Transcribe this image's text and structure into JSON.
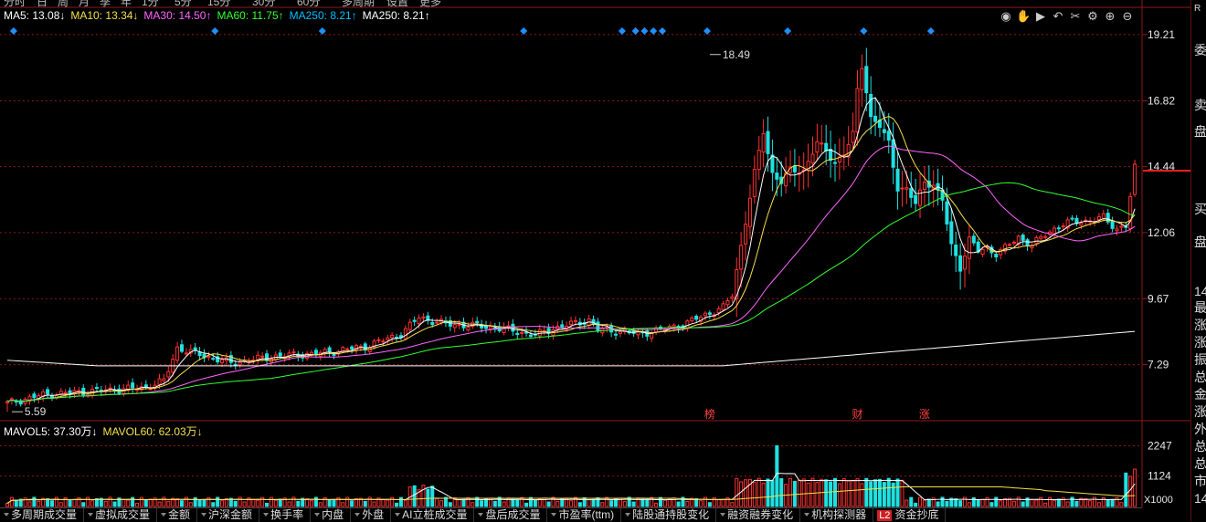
{
  "top_tabs": [
    "分时",
    "日",
    "周",
    "月",
    "季",
    "年",
    "1分",
    "5分",
    "15分",
    "30分",
    "60分",
    "多周期",
    "设置",
    "更多"
  ],
  "ma_legend": [
    {
      "label": "MA5: 13.08↓",
      "color": "#ffffff"
    },
    {
      "label": "MA10: 13.34↓",
      "color": "#f4e04a"
    },
    {
      "label": "MA30: 14.50↑",
      "color": "#ff66ff"
    },
    {
      "label": "MA60: 11.75↑",
      "color": "#33ff33"
    },
    {
      "label": "MA250: 8.21↑",
      "color": "#00bfff"
    },
    {
      "label": "MA250: 8.21↑",
      "color": "#ffffff"
    }
  ],
  "vol_legend": [
    {
      "label": "MAVOL5: 37.30万↓",
      "color": "#ffffff"
    },
    {
      "label": "MAVOL60: 62.03万↓",
      "color": "#f4e04a"
    }
  ],
  "toolbar_icons": [
    "eye-icon",
    "hand-icon",
    "play-icon",
    "undo-icon",
    "cross-icon",
    "gear-icon",
    "zoom-in-icon",
    "zoom-out-icon"
  ],
  "right_panel": {
    "top_icon": "R",
    "chars": [
      "委",
      "卖",
      "盘",
      "买",
      "盘",
      "14"
    ],
    "labels": [
      "最",
      "涨",
      "涨",
      "振",
      "总",
      "金",
      "涨",
      "外",
      "总",
      "总",
      "市",
      "14"
    ]
  },
  "colors": {
    "up": "#ff3030",
    "down": "#20e0e0",
    "grid": "#8b1a1a",
    "axis_text": "#e8e8e8",
    "ma5": "#ffffff",
    "ma10": "#f4e04a",
    "ma30": "#ff66ff",
    "ma60": "#33ff33",
    "ma250": "#ffffff"
  },
  "chart_data": {
    "type": "candlestick",
    "price_axis_ticks": [
      "19.21",
      "16.82",
      "14.44",
      "12.06",
      "9.67",
      "7.29"
    ],
    "price_ylim": [
      5.3,
      19.8
    ],
    "volume_axis_ticks": [
      "2247",
      "1124"
    ],
    "volume_unit": "X1000",
    "volume_ylim": [
      0,
      2600
    ],
    "annotations": [
      {
        "text": "18.49",
        "price": 18.49,
        "index": 157
      },
      {
        "text": "5.59",
        "price": 5.59,
        "index": 1
      }
    ],
    "event_markers": [
      {
        "text": "榜",
        "index": 157
      },
      {
        "text": "财",
        "index": 190
      },
      {
        "text": "涨",
        "index": 205
      }
    ],
    "diamond_indices": [
      1,
      46,
      70,
      115,
      137,
      140,
      142,
      144,
      146,
      156,
      174,
      191,
      206
    ],
    "candles": []
  },
  "bottom_tabs": [
    {
      "label": "多周期成交量"
    },
    {
      "label": "虚拟成交量"
    },
    {
      "label": "金额"
    },
    {
      "label": "沪深金额"
    },
    {
      "label": "换手率"
    },
    {
      "label": "内盘"
    },
    {
      "label": "外盘"
    },
    {
      "label": "AI立桩成交量"
    },
    {
      "label": "盘后成交量"
    },
    {
      "label": "市盈率(ttm)"
    },
    {
      "label": "陆股通持股变化"
    },
    {
      "label": "融资融券变化"
    },
    {
      "label": "机构探测器"
    },
    {
      "label": "资金抄底",
      "badge": "L2"
    }
  ]
}
